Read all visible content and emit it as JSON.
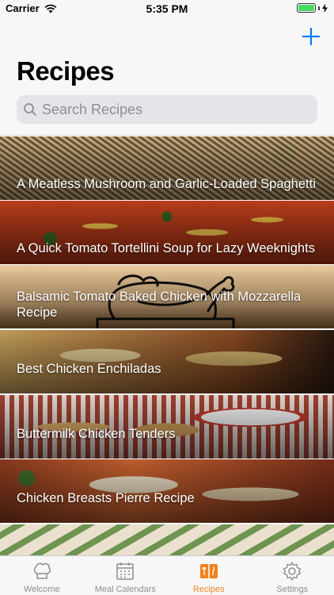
{
  "status_bar": {
    "carrier": "Carrier",
    "time": "5:35 PM",
    "battery_level": 1.0
  },
  "nav": {
    "title": "Recipes",
    "add_icon": "plus-icon"
  },
  "search": {
    "placeholder": "Search Recipes",
    "value": "",
    "icon": "search-icon"
  },
  "recipes": [
    {
      "title": "A Meatless Mushroom and Garlic-Loaded Spaghetti"
    },
    {
      "title": "A Quick Tomato Tortellini Soup for Lazy Weeknights"
    },
    {
      "title": "Balsamic Tomato Baked Chicken with Mozzarella Recipe"
    },
    {
      "title": "Best Chicken Enchiladas"
    },
    {
      "title": "Buttermilk Chicken Tenders"
    },
    {
      "title": "Chicken Breasts Pierre Recipe"
    },
    {
      "title": ""
    }
  ],
  "tabs": [
    {
      "label": "Welcome",
      "icon": "chef-hat-icon",
      "active": false
    },
    {
      "label": "Meal Calendars",
      "icon": "calendar-icon",
      "active": false
    },
    {
      "label": "Recipes",
      "icon": "recipe-book-icon",
      "active": true
    },
    {
      "label": "Settings",
      "icon": "gear-icon",
      "active": false
    }
  ],
  "colors": {
    "accent": "#007aff",
    "tab_active": "#f0821e",
    "tab_inactive": "#8e8e93",
    "battery": "#4cd964"
  }
}
